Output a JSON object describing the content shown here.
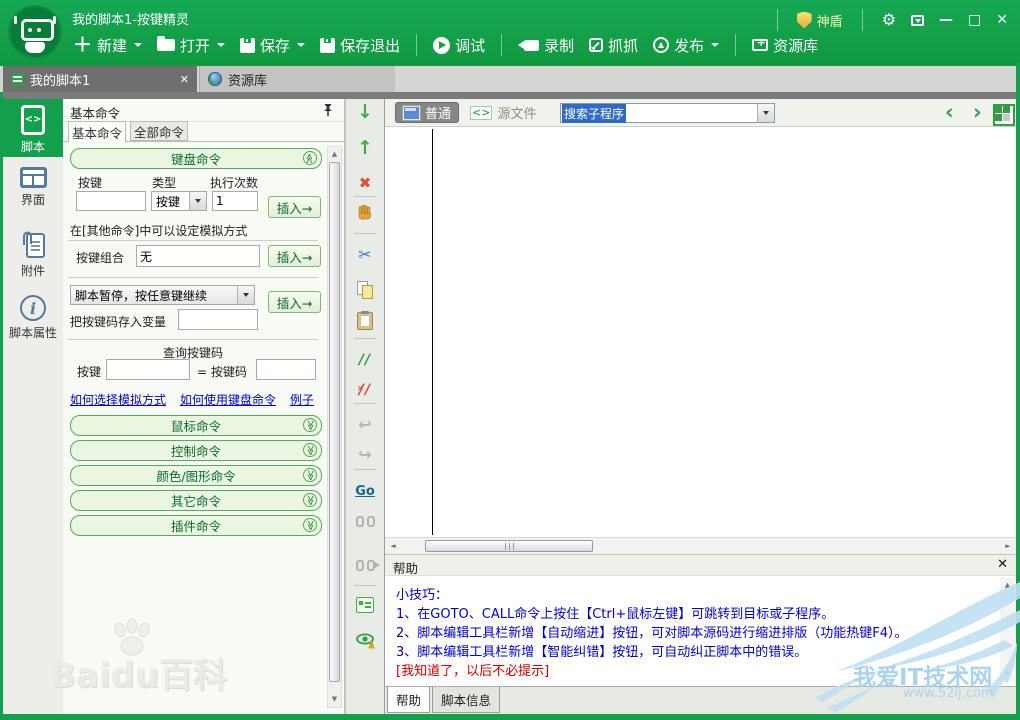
{
  "colors": {
    "accent_green": "#12a04d",
    "selection_blue": "#316ac5",
    "link_blue": "#0000cc",
    "help_text_blue": "#0000d0",
    "dismiss_red": "#d00000",
    "shield_gold": "#ffe26b"
  },
  "titlebar": {
    "title": "我的脚本1-按键精灵",
    "shield_label": "神盾",
    "buttons": [
      {
        "label": "新建",
        "icon": "plus-icon",
        "dropdown": true
      },
      {
        "label": "打开",
        "icon": "folder-icon",
        "dropdown": true
      },
      {
        "label": "保存",
        "icon": "save-icon",
        "dropdown": true
      },
      {
        "label": "保存退出",
        "icon": "save-exit-icon",
        "dropdown": false
      },
      {
        "label": "调试",
        "icon": "debug-icon",
        "dropdown": false
      },
      {
        "label": "录制",
        "icon": "record-icon",
        "dropdown": false
      },
      {
        "label": "抓抓",
        "icon": "capture-icon",
        "dropdown": false
      },
      {
        "label": "发布",
        "icon": "publish-icon",
        "dropdown": true
      },
      {
        "label": "资源库",
        "icon": "library-icon",
        "dropdown": false
      }
    ]
  },
  "tabs": [
    {
      "label": "我的脚本1",
      "icon": "script-doc-icon",
      "closable": true
    },
    {
      "label": "资源库",
      "icon": "globe-icon",
      "closable": false
    }
  ],
  "sidebar": [
    {
      "label": "脚本",
      "icon": "script-icon",
      "active": true
    },
    {
      "label": "界面",
      "icon": "ui-icon",
      "active": false
    },
    {
      "label": "附件",
      "icon": "attachment-icon",
      "active": false
    },
    {
      "label": "脚本属性",
      "icon": "script-properties-icon",
      "active": false
    }
  ],
  "panel": {
    "title": "基本命令",
    "tabs": [
      "基本命令",
      "全部命令"
    ],
    "keyboard": {
      "title": "键盘命令",
      "key_label": "按键",
      "type_label": "类型",
      "count_label": "执行次数",
      "key_value": "",
      "type_value": "按键",
      "count_value": "1",
      "insert_label": "插入→",
      "note": "在[其他命令]中可以设定模拟方式",
      "combo_label": "按键组合",
      "combo_value": "无",
      "pause_value": "脚本暂停，按任意键继续",
      "store_label": "把按键码存入变量",
      "store_value": "",
      "query_title": "查询按键码",
      "query_key_label": "按键",
      "query_eq_label": "= 按键码",
      "query_key_value": "",
      "query_code_value": "",
      "links": [
        "如何选择模拟方式",
        "如何使用键盘命令",
        "例子"
      ]
    },
    "sections": [
      "鼠标命令",
      "控制命令",
      "颜色/图形命令",
      "其它命令",
      "插件命令"
    ]
  },
  "midbar": {
    "go_label": "Go",
    "icons": [
      "move-down",
      "move-up",
      "delete",
      "hand-drag",
      "cut",
      "copy",
      "paste",
      "comment",
      "uncomment",
      "undo",
      "redo",
      "goto",
      "find",
      "find-next",
      "script-list",
      "syntax-check"
    ]
  },
  "editor": {
    "view_normal": "普通",
    "view_source": "源文件",
    "search_value": "搜索子程序"
  },
  "help": {
    "title": "帮助",
    "lines": [
      "小技巧：",
      "1、在GOTO、CALL命令上按住【Ctrl+鼠标左键】可跳转到目标或子程序。",
      "2、脚本编辑工具栏新增【自动缩进】按钮，可对脚本源码进行缩进排版（功能热键F4）。",
      "3、脚本编辑工具栏新增【智能纠错】按钮，可自动纠正脚本中的错误。"
    ],
    "dismiss": "[我知道了，以后不必提示]"
  },
  "bottom_tabs": [
    "帮助",
    "脚本信息"
  ],
  "watermarks": {
    "left_brand": "Baidu",
    "left_suffix": "百科",
    "right_title": "我爱IT技术网",
    "right_url": "www.52ij.com"
  }
}
